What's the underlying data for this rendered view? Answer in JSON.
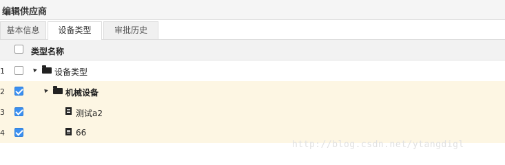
{
  "window": {
    "title": "编辑供应商"
  },
  "tabs": [
    {
      "label": "基本信息",
      "active": false
    },
    {
      "label": "设备类型",
      "active": true
    },
    {
      "label": "审批历史",
      "active": false
    }
  ],
  "tree": {
    "header_label": "类型名称",
    "header_checked": false,
    "rows": [
      {
        "num": "1",
        "label": "设备类型",
        "checked": false,
        "icon": "folder-open-icon",
        "expanded": true,
        "selected": false
      },
      {
        "num": "2",
        "label": "机械设备",
        "checked": true,
        "icon": "folder-open-icon",
        "expanded": true,
        "selected": true
      },
      {
        "num": "3",
        "label": "测试a2",
        "checked": true,
        "icon": "file-icon",
        "selected": true
      },
      {
        "num": "4",
        "label": "66",
        "checked": true,
        "icon": "file-icon",
        "selected": true
      }
    ]
  },
  "watermark": "http://blog.csdn.net/ytangdigl",
  "colors": {
    "selected_row_bg": "#fdf6e3",
    "checkbox_checked": "#3b8ff0",
    "header_bg": "#f2f2f2"
  }
}
